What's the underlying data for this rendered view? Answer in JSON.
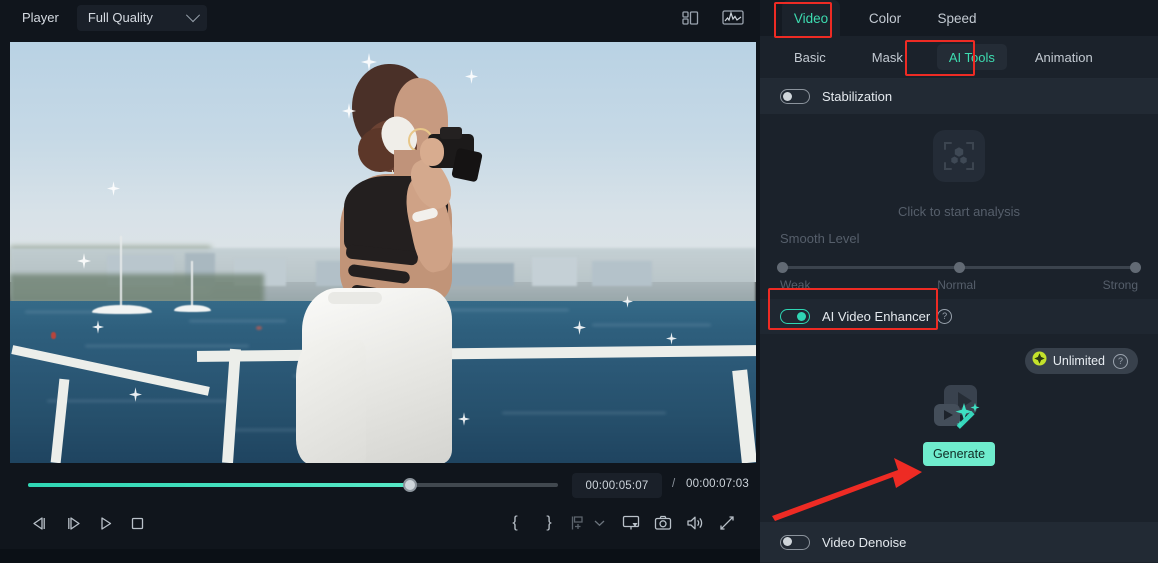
{
  "player": {
    "label": "Player",
    "quality": {
      "value": "Full Quality",
      "icon": "chevron-down-icon"
    },
    "header_icons": [
      {
        "name": "grid-layout-icon"
      },
      {
        "name": "waveform-scope-icon"
      }
    ],
    "timecode": {
      "current": "00:00:05:07",
      "separator": "/",
      "total": "00:00:07:03"
    },
    "progress_percent": 72,
    "transport": [
      {
        "name": "prev-frame-button",
        "glyph": "step-backward"
      },
      {
        "name": "next-frame-button",
        "glyph": "step-forward"
      },
      {
        "name": "play-button",
        "glyph": "play"
      },
      {
        "name": "stop-button",
        "glyph": "stop"
      }
    ],
    "right_tools": [
      {
        "name": "mark-in-button",
        "glyph": "{"
      },
      {
        "name": "mark-out-button",
        "glyph": "}"
      },
      {
        "name": "add-marker-button",
        "glyph": "marker",
        "disabled": true
      },
      {
        "name": "marker-dropdown-button",
        "glyph": "chevron-down"
      },
      {
        "name": "snapshot-to-button",
        "glyph": "monitor"
      },
      {
        "name": "screenshot-button",
        "glyph": "camera"
      },
      {
        "name": "volume-button",
        "glyph": "speaker"
      },
      {
        "name": "fullscreen-button",
        "glyph": "expand"
      }
    ]
  },
  "panel": {
    "primary_tabs": [
      {
        "label": "Video",
        "active": true
      },
      {
        "label": "Color",
        "active": false
      },
      {
        "label": "Speed",
        "active": false
      }
    ],
    "secondary_tabs": [
      {
        "label": "Basic",
        "active": false
      },
      {
        "label": "Mask",
        "active": false
      },
      {
        "label": "AI Tools",
        "active": true
      },
      {
        "label": "Animation",
        "active": false
      }
    ],
    "stabilization": {
      "title": "Stabilization",
      "enabled": false,
      "analysis_text": "Click to start analysis",
      "smooth_level_label": "Smooth Level",
      "slider_labels": {
        "min": "Weak",
        "mid": "Normal",
        "max": "Strong"
      },
      "slider_value_percent": 50
    },
    "ai_video_enhancer": {
      "title": "AI Video Enhancer",
      "enabled": true,
      "help_icon": "question-mark-icon",
      "badge": {
        "label": "Unlimited",
        "icon": "diamond-icon",
        "help_icon": "question-mark-icon"
      },
      "generate_label": "Generate"
    },
    "video_denoise": {
      "title": "Video Denoise",
      "enabled": false
    }
  },
  "annotations": {
    "highlight_color": "#ee2b24",
    "boxes": [
      {
        "name": "video-tab-highlight"
      },
      {
        "name": "ai-tools-tab-highlight"
      },
      {
        "name": "ai-video-enhancer-highlight"
      }
    ],
    "arrow": {
      "name": "generate-button-arrow",
      "points_to": "Generate"
    }
  },
  "colors": {
    "accent_teal": "#3ddcb0",
    "generate_button": "#6feccd",
    "panel_bg": "#1b222b",
    "player_bg": "#10151c",
    "badge_green": "#bfe02a",
    "annotation_red": "#ee2b24"
  }
}
